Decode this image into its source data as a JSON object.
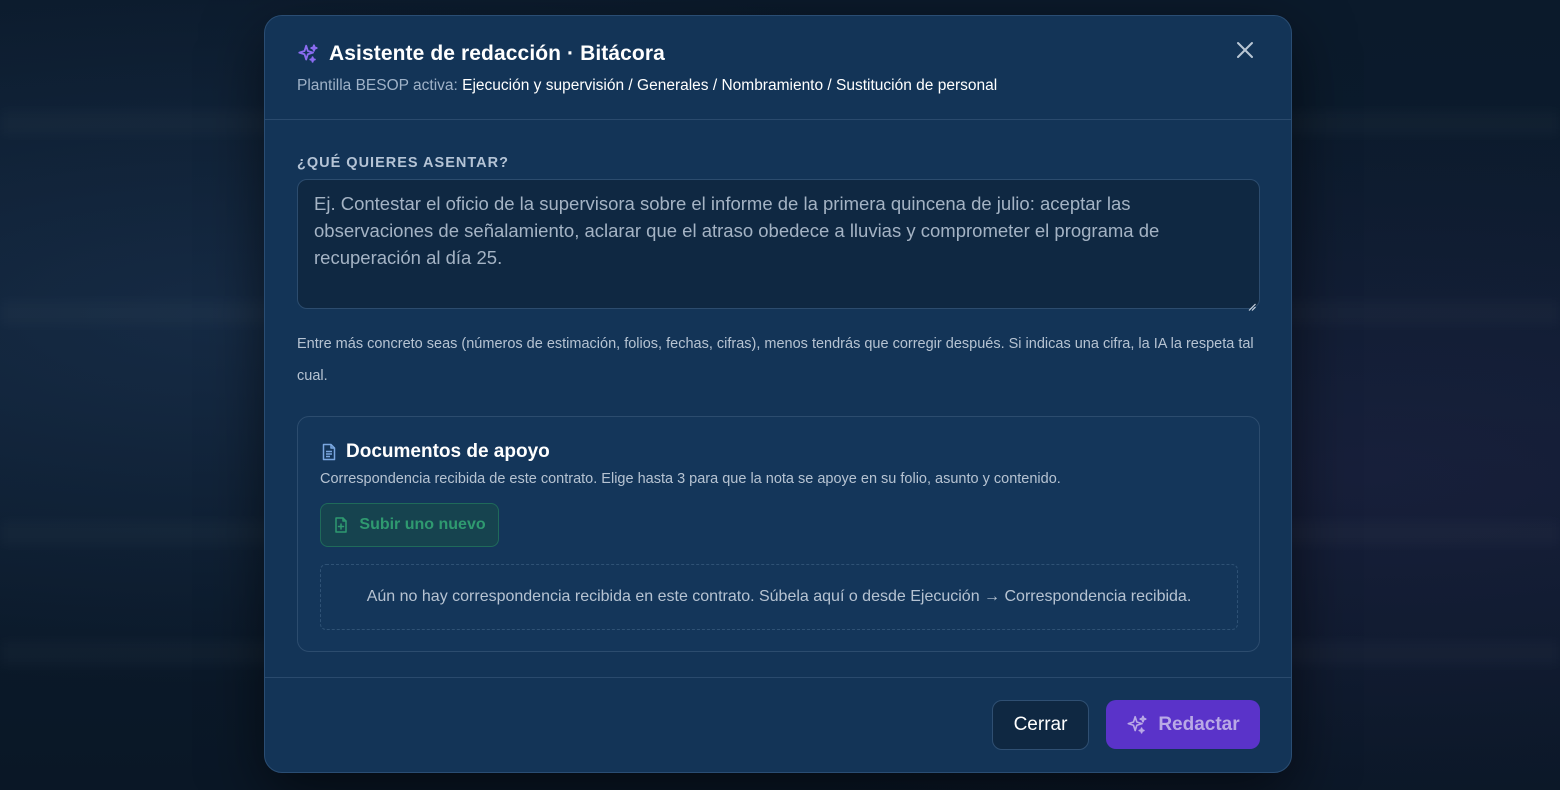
{
  "modal": {
    "title": "Asistente de redacción · Bitácora",
    "template_prefix": "Plantilla BESOP activa:",
    "template_path": "Ejecución y supervisión / Generales / Nombramiento / Sustitución de personal",
    "close_icon": "close-icon",
    "title_icon": "sparkles-icon"
  },
  "prompt": {
    "label": "¿QUÉ QUIERES ASENTAR?",
    "value": "",
    "placeholder": "Ej. Contestar el oficio de la supervisora sobre el informe de la primera quincena de julio: aceptar las observaciones de señalamiento, aclarar que el atraso obedece a lluvias y comprometer el programa de recuperación al día 25.",
    "hint": "Entre más concreto seas (números de estimación, folios, fechas, cifras), menos tendrás que corregir después. Si indicas una cifra, la IA la respeta tal cual."
  },
  "documents": {
    "title": "Documentos de apoyo",
    "icon": "document-icon",
    "description": "Correspondencia recibida de este contrato. Elige hasta 3 para que la nota se apoye en su folio, asunto y contenido.",
    "upload_label": "Subir uno nuevo",
    "upload_icon": "file-plus-icon",
    "empty_message": "Aún no hay correspondencia recibida en este contrato. Súbela aquí o desde Ejecución → Correspondencia recibida."
  },
  "footer": {
    "cancel_label": "Cerrar",
    "submit_label": "Redactar",
    "submit_icon": "sparkles-icon"
  },
  "colors": {
    "modal_bg": "#133457",
    "accent_purple": "#5a33c9",
    "upload_green": "#2f9a70",
    "text_primary": "#ffffff",
    "text_muted": "#b6c3d2"
  }
}
